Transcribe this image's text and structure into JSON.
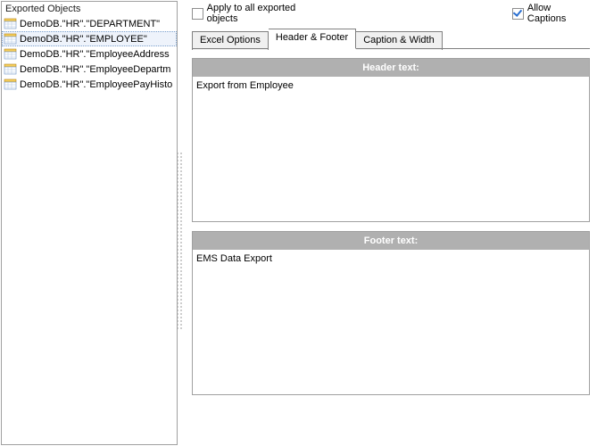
{
  "leftPanel": {
    "title": "Exported Objects",
    "items": [
      {
        "label": "DemoDB.\"HR\".\"DEPARTMENT\"",
        "selected": false
      },
      {
        "label": "DemoDB.\"HR\".\"EMPLOYEE\"",
        "selected": true
      },
      {
        "label": "DemoDB.\"HR\".\"EmployeeAddress",
        "selected": false
      },
      {
        "label": "DemoDB.\"HR\".\"EmployeeDepartm",
        "selected": false
      },
      {
        "label": "DemoDB.\"HR\".\"EmployeePayHisto",
        "selected": false
      }
    ]
  },
  "checkboxes": {
    "applyAllLabel": "Apply to all exported objects",
    "applyAllChecked": false,
    "allowCaptionsLabel": "Allow Captions",
    "allowCaptionsChecked": true
  },
  "tabs": {
    "items": [
      {
        "label": "Excel Options",
        "active": false
      },
      {
        "label": "Header & Footer",
        "active": true
      },
      {
        "label": "Caption & Width",
        "active": false
      }
    ]
  },
  "headerSection": {
    "title": "Header text:",
    "value": "Export from Employee"
  },
  "footerSection": {
    "title": "Footer text:",
    "value": "EMS Data Export"
  }
}
